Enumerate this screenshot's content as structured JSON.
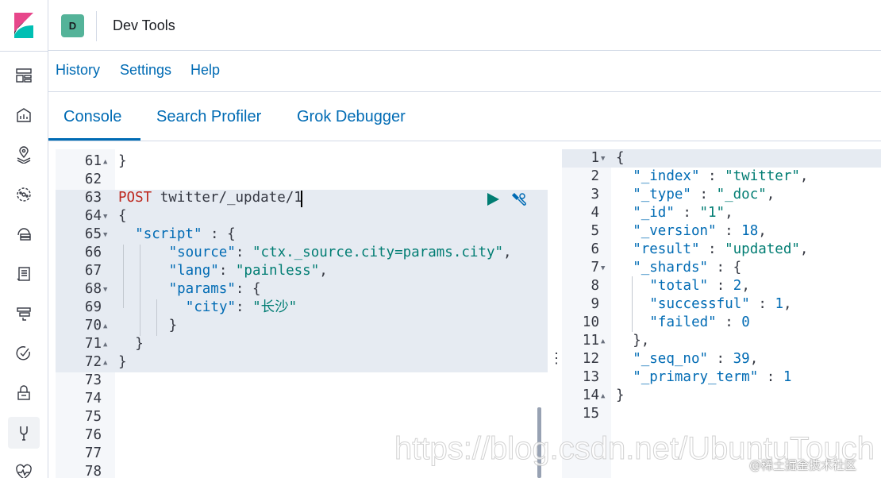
{
  "header": {
    "space_avatar": "D",
    "title": "Dev Tools"
  },
  "topmenu": {
    "history": "History",
    "settings": "Settings",
    "help": "Help"
  },
  "tabs": [
    "Console",
    "Search Profiler",
    "Grok Debugger"
  ],
  "active_tab": "Console",
  "nav_icons": [
    "dashboard-icon",
    "canvas-icon",
    "maps-icon",
    "ml-icon",
    "infrastructure-icon",
    "logs-icon",
    "apm-icon",
    "uptime-icon",
    "siem-icon",
    "dev-tools-icon",
    "monitoring-icon"
  ],
  "request_editor": {
    "lines": [
      {
        "n": "61",
        "fold": "up",
        "text": "}"
      },
      {
        "n": "62",
        "fold": "",
        "text": ""
      },
      {
        "n": "63",
        "fold": "",
        "method": "POST",
        "text": " twitter/_update/1"
      },
      {
        "n": "64",
        "fold": "down",
        "text": "{"
      },
      {
        "n": "65",
        "fold": "down",
        "key": "\"script\"",
        "text": " : {"
      },
      {
        "n": "66",
        "fold": "",
        "key": "\"source\"",
        "sep": ": ",
        "val": "\"ctx._source.city=params.city\"",
        "tail": ","
      },
      {
        "n": "67",
        "fold": "",
        "key": "\"lang\"",
        "sep": ": ",
        "val": "\"painless\"",
        "tail": ","
      },
      {
        "n": "68",
        "fold": "down",
        "key": "\"params\"",
        "text": ": {"
      },
      {
        "n": "69",
        "fold": "",
        "key": "\"city\"",
        "sep": ": ",
        "val": "\"长沙\"",
        "tail": ""
      },
      {
        "n": "70",
        "fold": "up",
        "text": "}"
      },
      {
        "n": "71",
        "fold": "up",
        "text": "}"
      },
      {
        "n": "72",
        "fold": "up",
        "text": "}"
      },
      {
        "n": "73",
        "fold": "",
        "text": ""
      },
      {
        "n": "74",
        "fold": "",
        "text": ""
      },
      {
        "n": "75",
        "fold": "",
        "text": ""
      },
      {
        "n": "76",
        "fold": "",
        "text": ""
      },
      {
        "n": "77",
        "fold": "",
        "text": ""
      },
      {
        "n": "78",
        "fold": "",
        "text": ""
      }
    ]
  },
  "response_editor": {
    "lines": [
      {
        "n": "1",
        "fold": "down",
        "text": "{"
      },
      {
        "n": "2",
        "fold": "",
        "key": "\"_index\"",
        "sep": " : ",
        "val": "\"twitter\"",
        "tail": ","
      },
      {
        "n": "3",
        "fold": "",
        "key": "\"_type\"",
        "sep": " : ",
        "val": "\"_doc\"",
        "tail": ","
      },
      {
        "n": "4",
        "fold": "",
        "key": "\"_id\"",
        "sep": " : ",
        "val": "\"1\"",
        "tail": ","
      },
      {
        "n": "5",
        "fold": "",
        "key": "\"_version\"",
        "sep": " : ",
        "num": "18",
        "tail": ","
      },
      {
        "n": "6",
        "fold": "",
        "key": "\"result\"",
        "sep": " : ",
        "val": "\"updated\"",
        "tail": ","
      },
      {
        "n": "7",
        "fold": "down",
        "key": "\"_shards\"",
        "text": " : {"
      },
      {
        "n": "8",
        "fold": "",
        "key": "\"total\"",
        "sep": " : ",
        "num": "2",
        "tail": ","
      },
      {
        "n": "9",
        "fold": "",
        "key": "\"successful\"",
        "sep": " : ",
        "num": "1",
        "tail": ","
      },
      {
        "n": "10",
        "fold": "",
        "key": "\"failed\"",
        "sep": " : ",
        "num": "0",
        "tail": ""
      },
      {
        "n": "11",
        "fold": "up",
        "text": "},"
      },
      {
        "n": "12",
        "fold": "",
        "key": "\"_seq_no\"",
        "sep": " : ",
        "num": "39",
        "tail": ","
      },
      {
        "n": "13",
        "fold": "",
        "key": "\"_primary_term\"",
        "sep": " : ",
        "num": "1",
        "tail": ""
      },
      {
        "n": "14",
        "fold": "up",
        "text": "}"
      },
      {
        "n": "15",
        "fold": "",
        "text": ""
      }
    ]
  },
  "watermark": "https://blog.csdn.net/UbuntuTouch",
  "watermark2": "@稀土掘金技术社区",
  "colors": {
    "accent": "#006bb4",
    "space": "#54b399",
    "method": "#bd271e",
    "string": "#017d73"
  }
}
